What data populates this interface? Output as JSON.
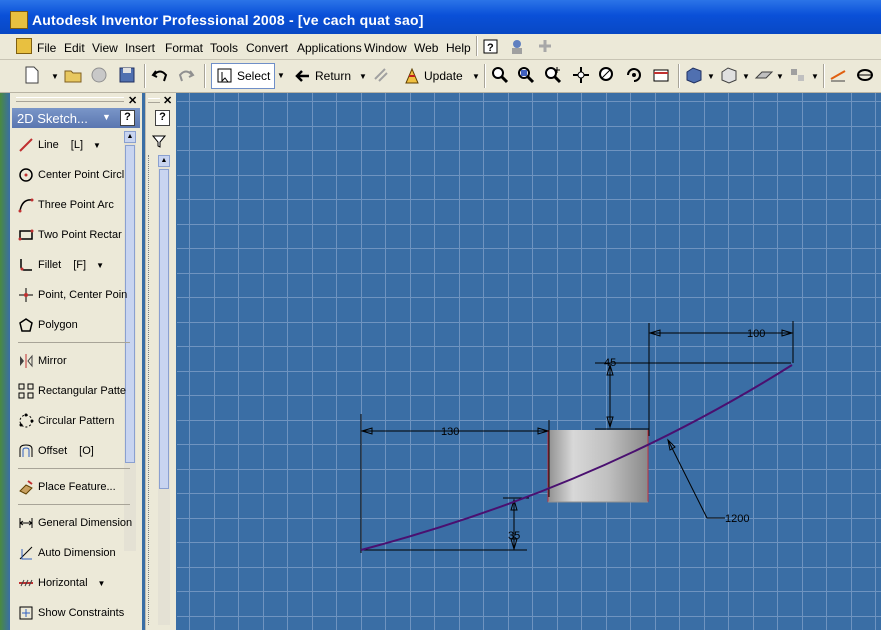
{
  "window": {
    "title": "Autodesk Inventor Professional 2008 - [ve cach quat sao]"
  },
  "menu": [
    "File",
    "Edit",
    "View",
    "Insert",
    "Format",
    "Tools",
    "Convert",
    "Applications",
    "Window",
    "Web",
    "Help"
  ],
  "toolbar": {
    "select_label": "Select",
    "return_label": "Return",
    "update_label": "Update"
  },
  "panel": {
    "title": "2D Sketch...",
    "help_glyph": "?",
    "items": [
      {
        "label": "Line",
        "shortcut": "[L]"
      },
      {
        "label": "Center Point Circl"
      },
      {
        "label": "Three Point Arc"
      },
      {
        "label": "Two Point Rectar"
      },
      {
        "label": "Fillet",
        "shortcut": "[F]"
      },
      {
        "label": "Point, Center Poin"
      },
      {
        "label": "Polygon"
      },
      {
        "label": "Mirror"
      },
      {
        "label": "Rectangular Patte"
      },
      {
        "label": "Circular Pattern"
      },
      {
        "label": "Offset",
        "shortcut": "[O]"
      },
      {
        "label": "Place Feature..."
      },
      {
        "label": "General Dimension"
      },
      {
        "label": "Auto Dimension"
      },
      {
        "label": "Horizontal"
      },
      {
        "label": "Show Constraints"
      }
    ]
  },
  "browser": {
    "help_glyph": "?"
  },
  "sketch": {
    "dimensions": {
      "d100": "100",
      "d45": "45",
      "d130": "130",
      "d35": "35",
      "d1200": "1200"
    }
  },
  "colors": {
    "canvas": "#3a6ea5",
    "grid": "#6f94c0",
    "curve": "#4a1070",
    "title_bar": "#0a50d8"
  }
}
